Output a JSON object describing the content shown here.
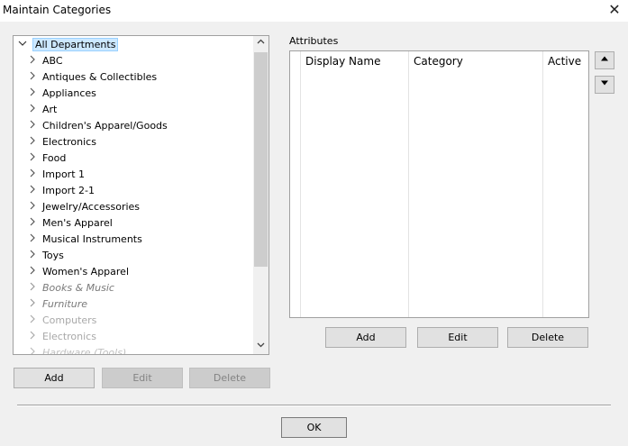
{
  "window": {
    "title": "Maintain Categories",
    "close_glyph": "✕"
  },
  "tree": {
    "root_label": "All Departments",
    "items": [
      "ABC",
      "Antiques & Collectibles",
      "Appliances",
      "Art",
      "Children's Apparel/Goods",
      "Electronics",
      "Food",
      "Import 1",
      "Import 2-1",
      "Jewelry/Accessories",
      "Men's Apparel",
      "Musical Instruments",
      "Toys",
      "Women's Apparel",
      "Books & Music",
      "Furniture",
      "Computers",
      "Electronics",
      "Hardware (Tools)"
    ]
  },
  "tree_buttons": {
    "add": "Add",
    "edit": "Edit",
    "delete": "Delete"
  },
  "attributes": {
    "label": "Attributes",
    "columns": [
      "Display Name",
      "Category",
      "Active"
    ],
    "rows": []
  },
  "attribute_buttons": {
    "add": "Add",
    "edit": "Edit",
    "delete": "Delete"
  },
  "move_buttons": {
    "up_icon": "triangle-up-icon",
    "down_icon": "triangle-down-icon"
  },
  "footer": {
    "ok": "OK"
  }
}
